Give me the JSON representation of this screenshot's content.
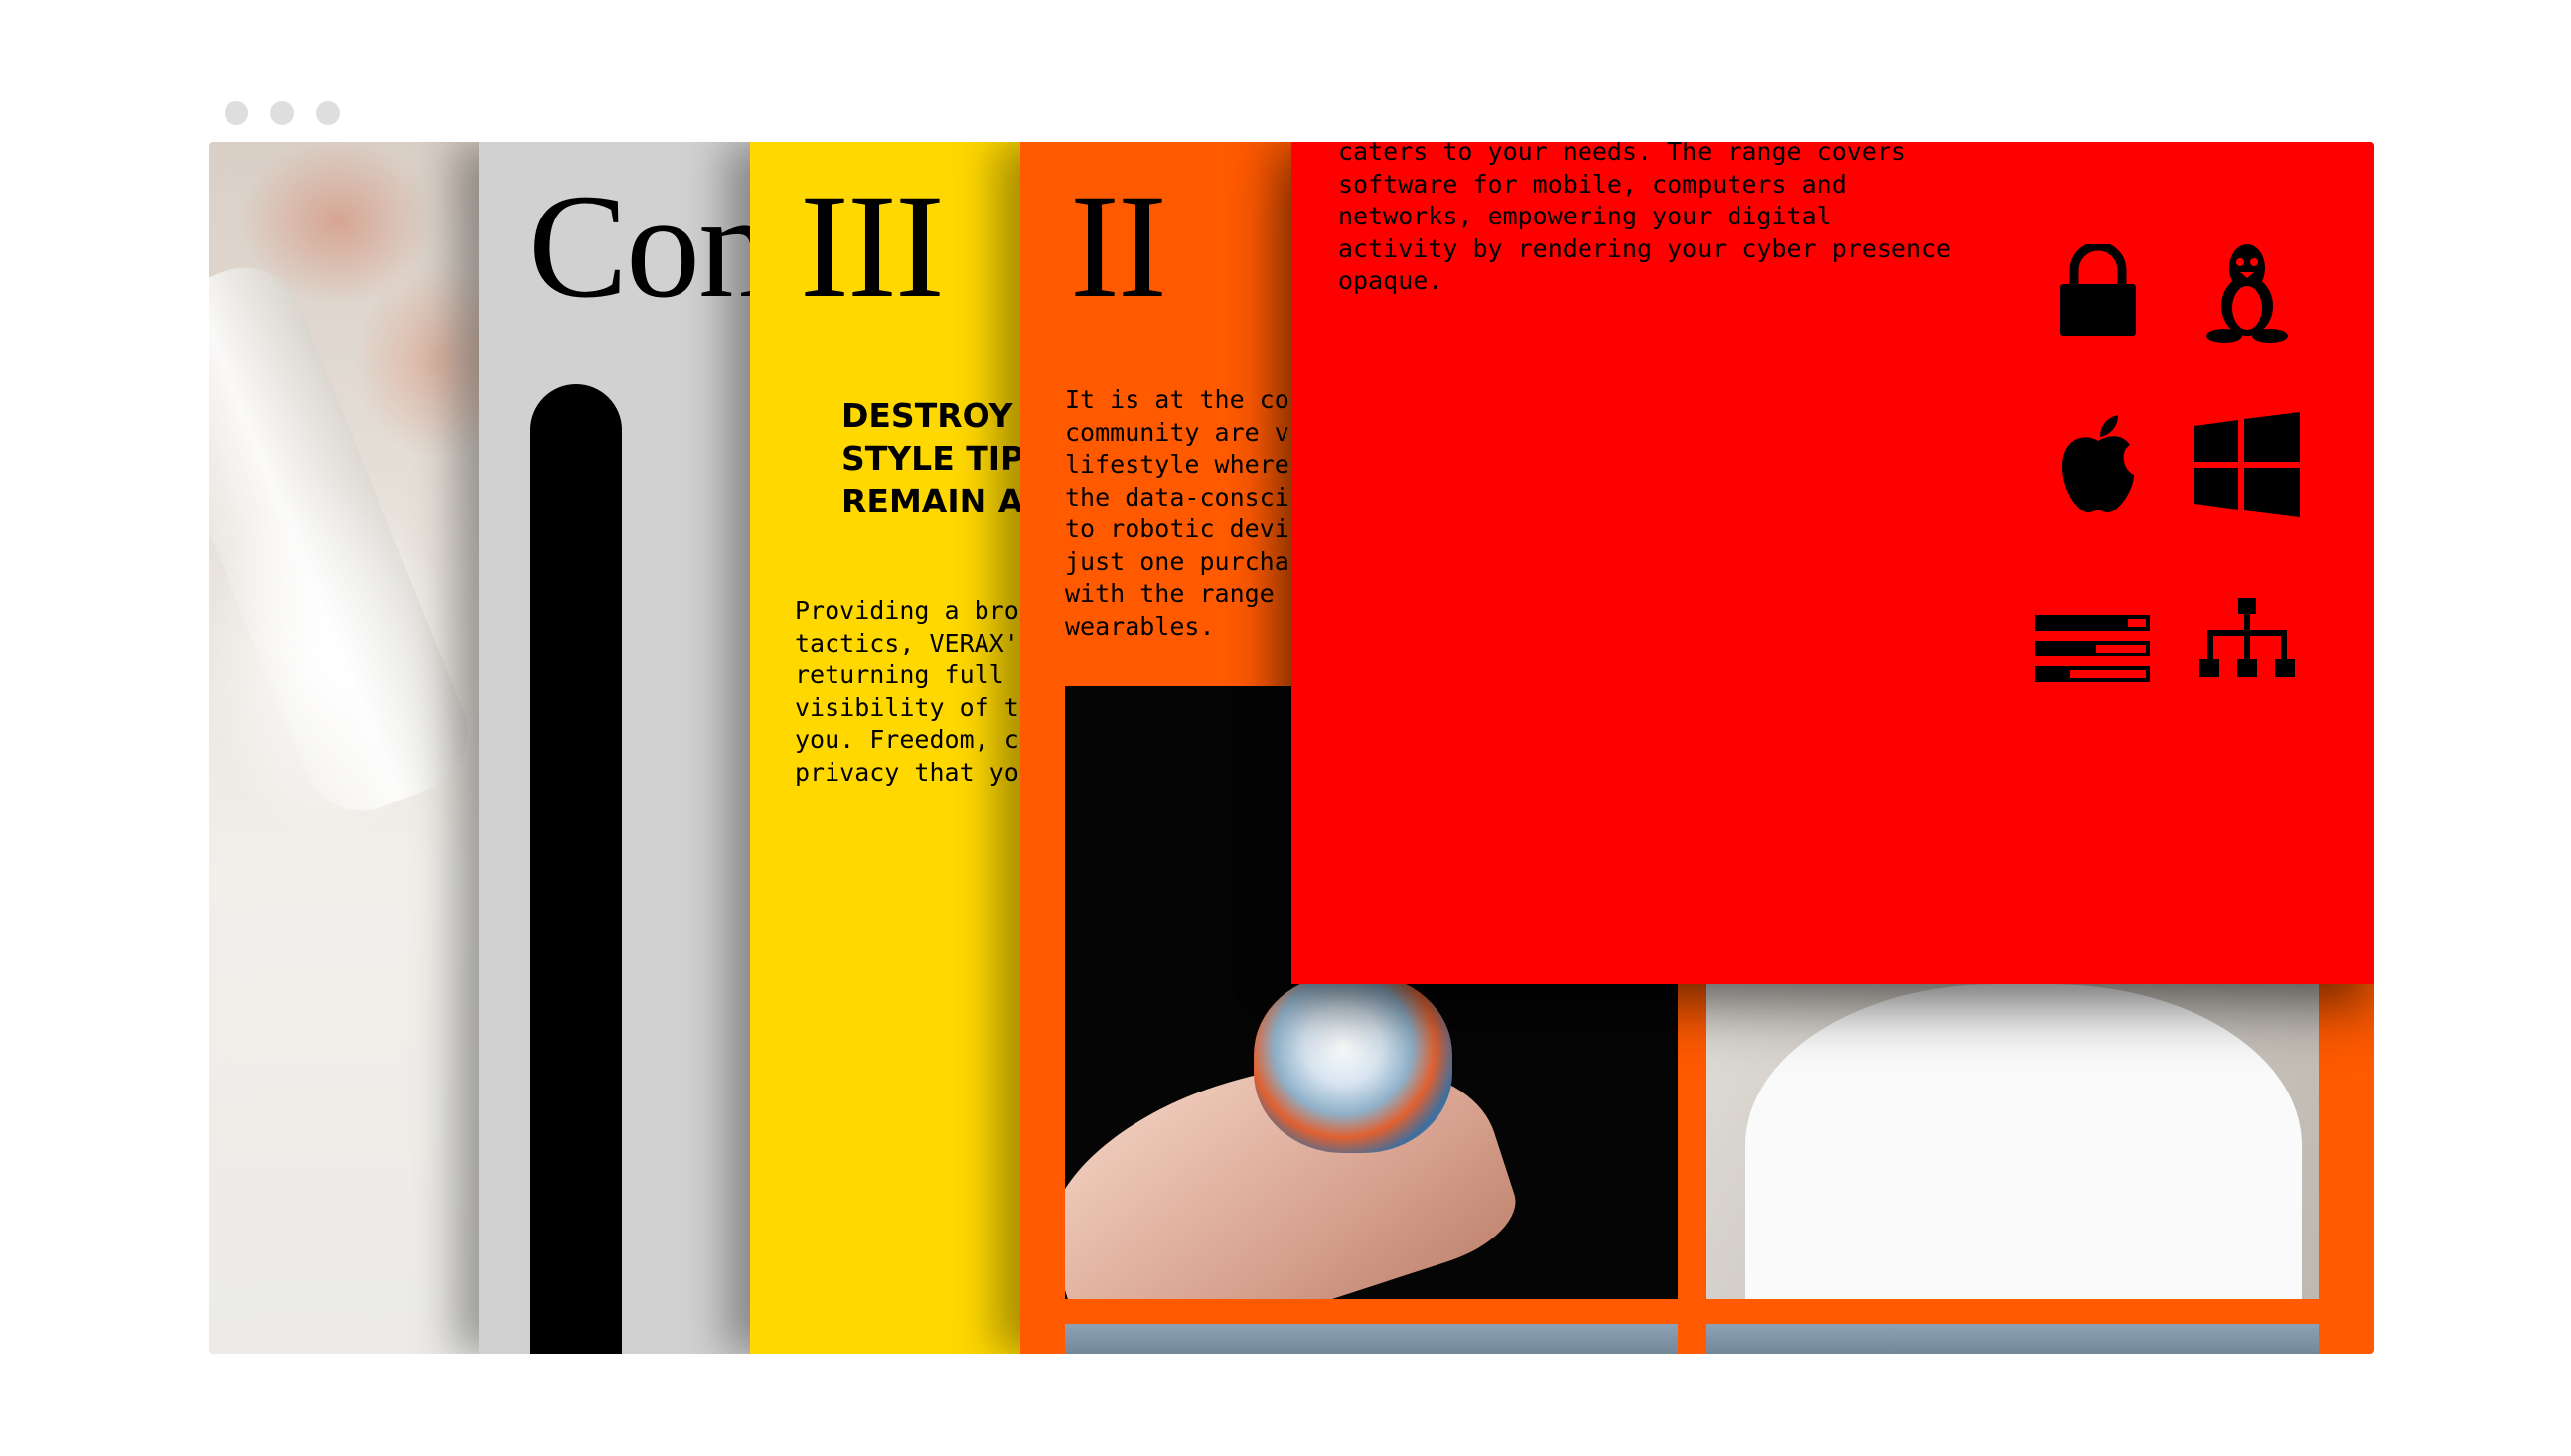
{
  "browser": {
    "window_controls": [
      "dot",
      "dot",
      "dot"
    ]
  },
  "panels": {
    "grey": {
      "numeral": "Con"
    },
    "yellow": {
      "numeral": "III",
      "headline": "DESTROY S\nSTYLE TIP\nREMAIN AN",
      "body": "Providing a bro\ntactics, VERAX'\nreturning full\nvisibility of t\nyou. Freedom, c\nprivacy that yo"
    },
    "orange": {
      "numeral": "II",
      "body": "It is at the co\ncommunity are v\nlifestyle where\nthe data-consci\nto robotic devi\njust one purcha\nwith the range\nwearables."
    },
    "red": {
      "body": "caters to your needs. The range covers\nsoftware for mobile, computers and\nnetworks, empowering your digital\nactivity by rendering your cyber presence\nopaque.",
      "icons": [
        "lock-icon",
        "linux-icon",
        "apple-icon",
        "windows-icon",
        "settings-bars-icon",
        "network-icon"
      ]
    }
  },
  "colors": {
    "grey": "#d1d1d1",
    "yellow": "#ffd800",
    "orange": "#ff5a00",
    "red": "#ff0000"
  }
}
